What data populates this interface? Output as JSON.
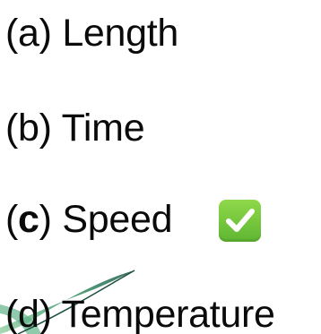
{
  "options": [
    {
      "prefix": "(a)",
      "label": "Length"
    },
    {
      "open": "(",
      "letter": "b",
      "close": ")",
      "label": "Time"
    },
    {
      "open": "(",
      "letter": "c",
      "close": ")",
      "label": "Speed"
    },
    {
      "prefix": "(d)",
      "label": "Temperature"
    }
  ],
  "correct_marker": {
    "icon": "check-mark-icon",
    "color": "#6cc23a"
  },
  "feather_icon": {
    "icon": "quill-feather-icon",
    "color": "#2f7a56"
  }
}
